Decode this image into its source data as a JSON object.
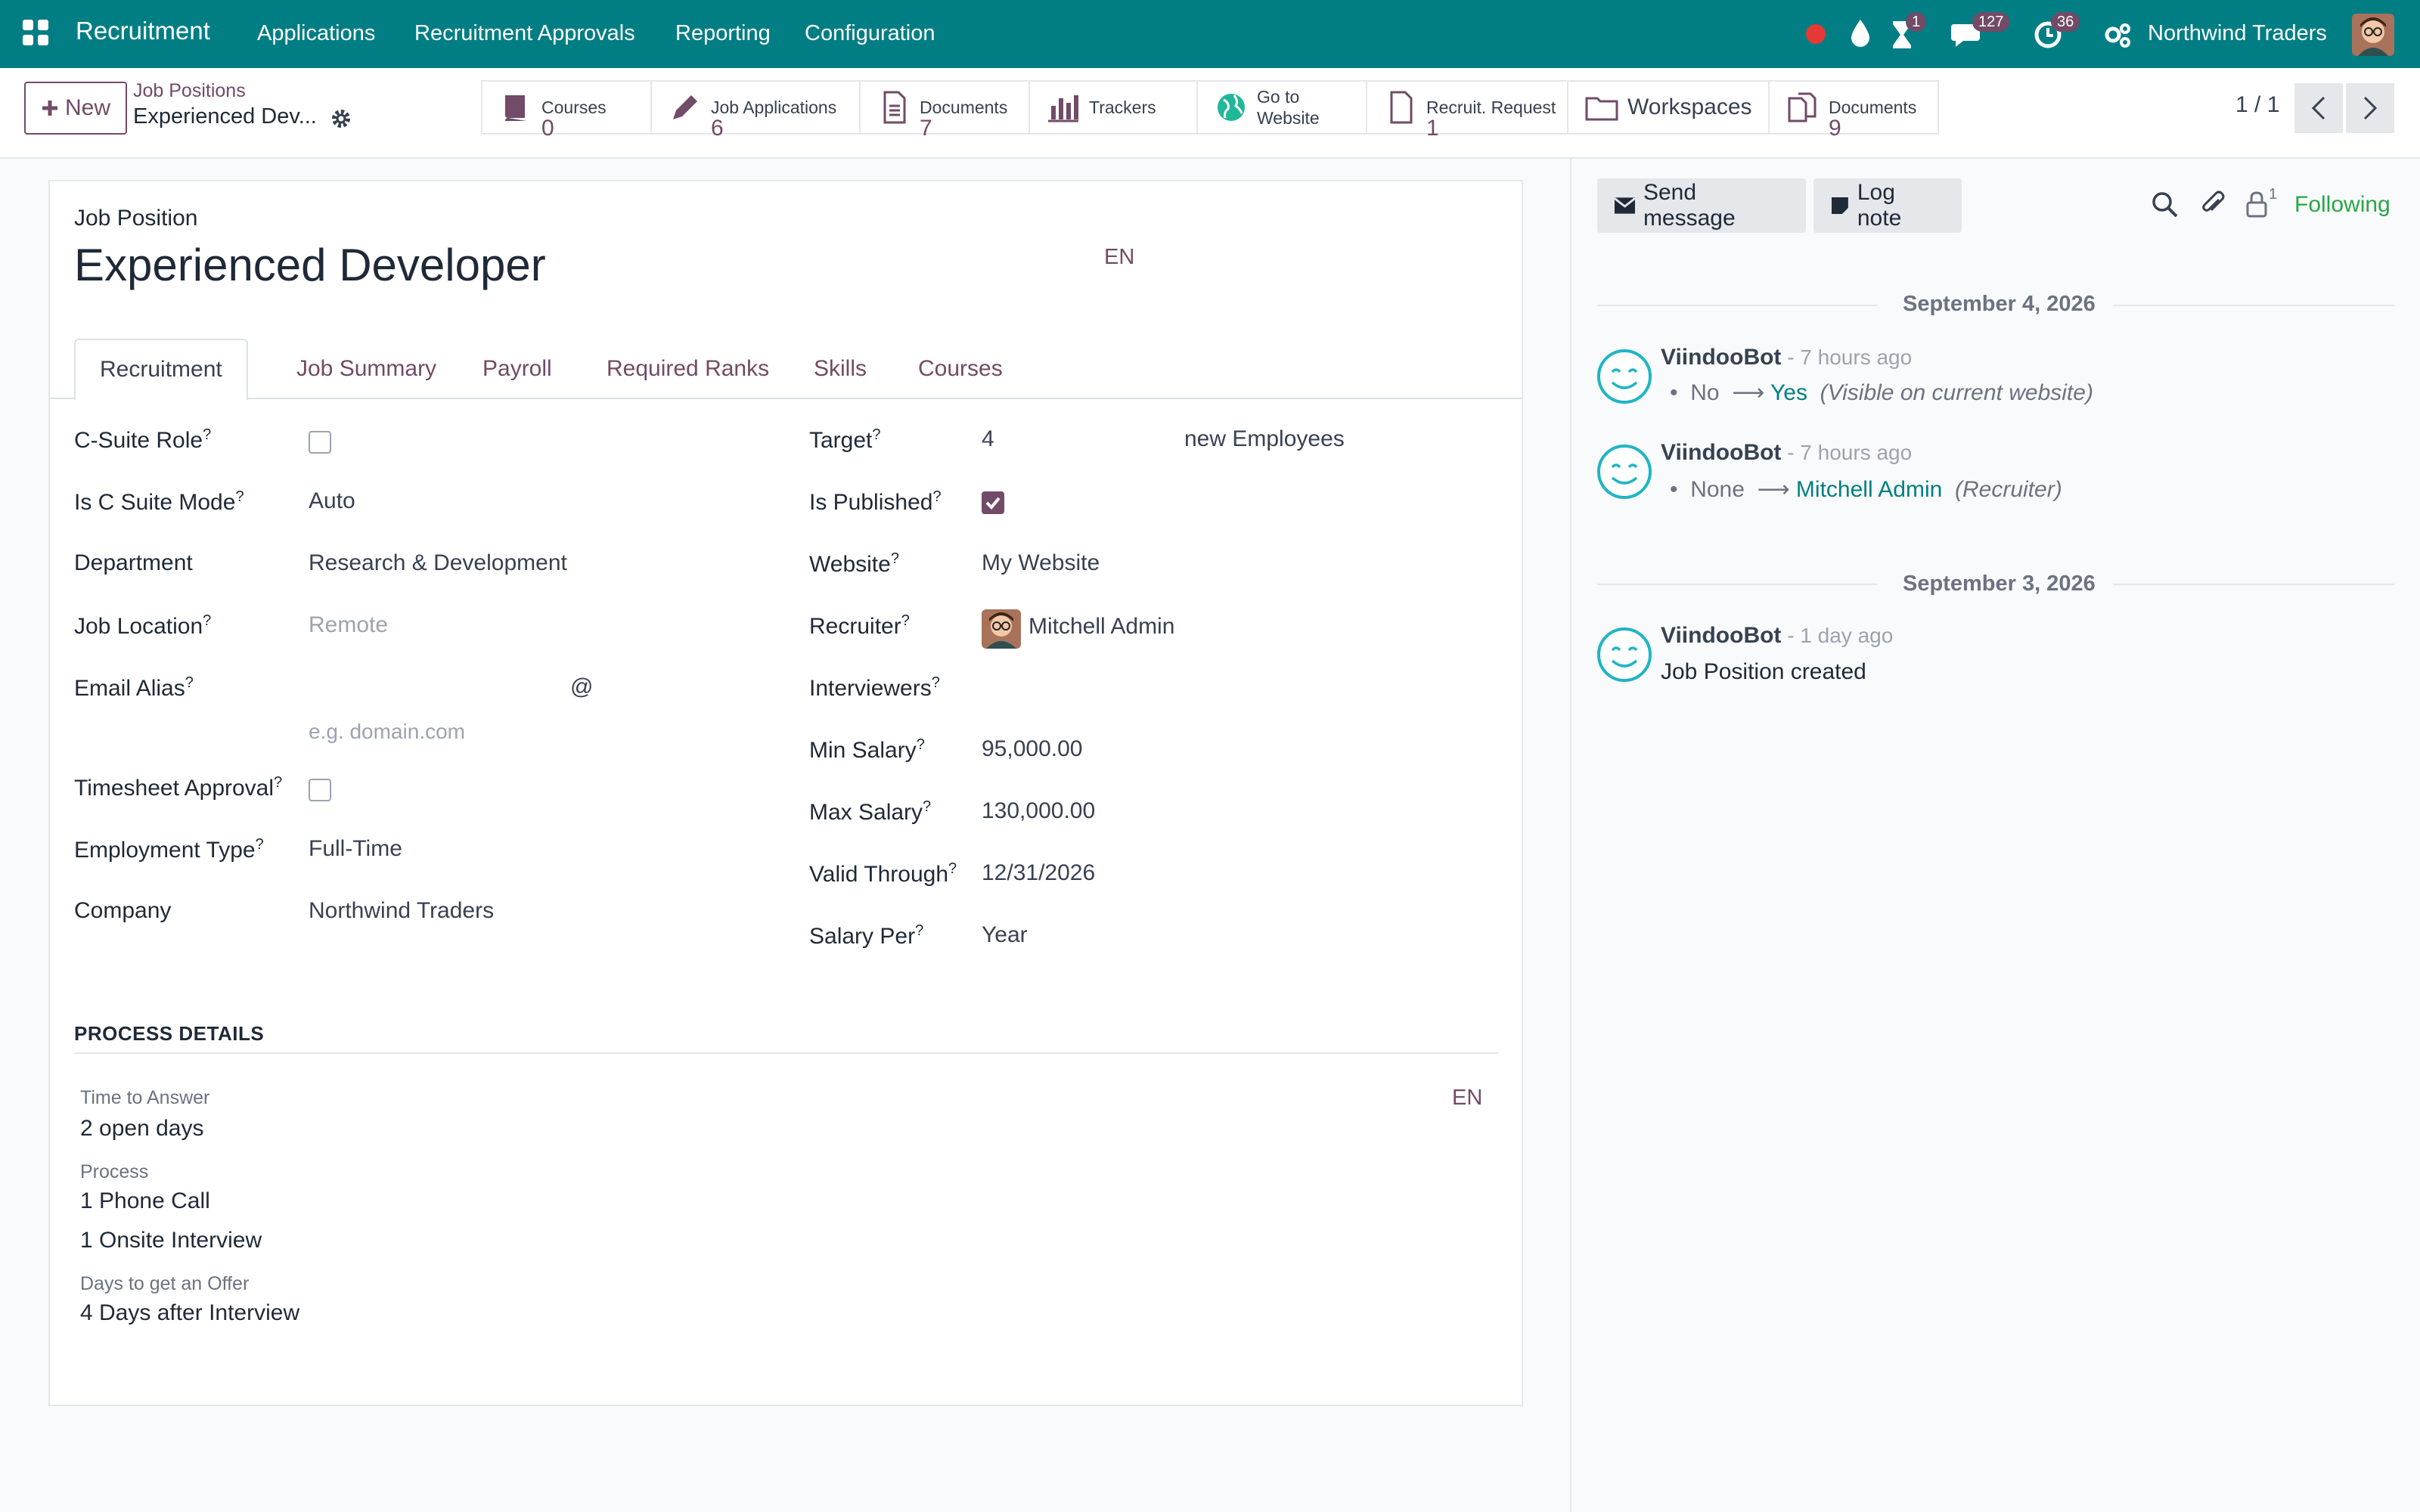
{
  "navbar": {
    "app_name": "Recruitment",
    "menu": [
      "Applications",
      "Recruitment Approvals",
      "Reporting",
      "Configuration"
    ],
    "badges": {
      "activities": "1",
      "messages": "127",
      "clock": "36"
    },
    "company": "Northwind Traders"
  },
  "control": {
    "new_label": "New",
    "breadcrumb_parent": "Job Positions",
    "breadcrumb_current": "Experienced Dev...",
    "smart_buttons": [
      {
        "label": "Courses",
        "value": "0"
      },
      {
        "label": "Job Applications",
        "value": "6"
      },
      {
        "label": "Documents",
        "value": "7"
      },
      {
        "label": "Trackers"
      },
      {
        "label": "Go to",
        "label2": "Website"
      },
      {
        "label": "Recruit. Request",
        "value": "1"
      },
      {
        "label": "Workspaces"
      },
      {
        "label": "Documents",
        "value": "9"
      }
    ],
    "pager": "1 / 1"
  },
  "form": {
    "record_label": "Job Position",
    "title": "Experienced Developer",
    "lang": "EN",
    "tabs": [
      "Recruitment",
      "Job Summary",
      "Payroll",
      "Required Ranks",
      "Skills",
      "Courses"
    ],
    "left_fields": {
      "c_suite_role": "C-Suite Role",
      "c_suite_mode": "Is C Suite Mode",
      "c_suite_mode_val": "Auto",
      "department": "Department",
      "department_val": "Research & Development",
      "job_location": "Job Location",
      "job_location_ph": "Remote",
      "email_alias": "Email Alias",
      "email_at": "@",
      "email_domain_ph": "e.g. domain.com",
      "timesheet": "Timesheet Approval",
      "employment_type": "Employment Type",
      "employment_type_val": "Full-Time",
      "company": "Company",
      "company_val": "Northwind Traders"
    },
    "right_fields": {
      "target": "Target",
      "target_val": "4",
      "target_unit": "new Employees",
      "published": "Is Published",
      "website": "Website",
      "website_val": "My Website",
      "recruiter": "Recruiter",
      "recruiter_val": "Mitchell Admin",
      "interviewers": "Interviewers",
      "min_salary": "Min Salary",
      "min_salary_val": "95,000.00",
      "max_salary": "Max Salary",
      "max_salary_val": "130,000.00",
      "valid_through": "Valid Through",
      "valid_through_val": "12/31/2026",
      "salary_per": "Salary Per",
      "salary_per_val": "Year"
    },
    "process": {
      "heading": "PROCESS DETAILS",
      "lang": "EN",
      "time_label": "Time to Answer",
      "time_val": "2 open days",
      "process_label": "Process",
      "process_1": "1 Phone Call",
      "process_2": "1 Onsite Interview",
      "days_label": "Days to get an Offer",
      "days_val": "4 Days after Interview"
    }
  },
  "chatter": {
    "send_message": "Send message",
    "log_note": "Log note",
    "followers_count": "1",
    "following": "Following",
    "dates": [
      "September 4, 2026",
      "September 3, 2026"
    ],
    "messages": [
      {
        "author": "ViindooBot",
        "time": " - 7 hours ago",
        "old": "No",
        "new": "Yes",
        "desc": "(Visible on current website)"
      },
      {
        "author": "ViindooBot",
        "time": " - 7 hours ago",
        "old": "None",
        "new": "Mitchell Admin",
        "desc": "(Recruiter)"
      },
      {
        "author": "ViindooBot",
        "time": " - 1 day ago",
        "text": "Job Position created"
      }
    ]
  }
}
